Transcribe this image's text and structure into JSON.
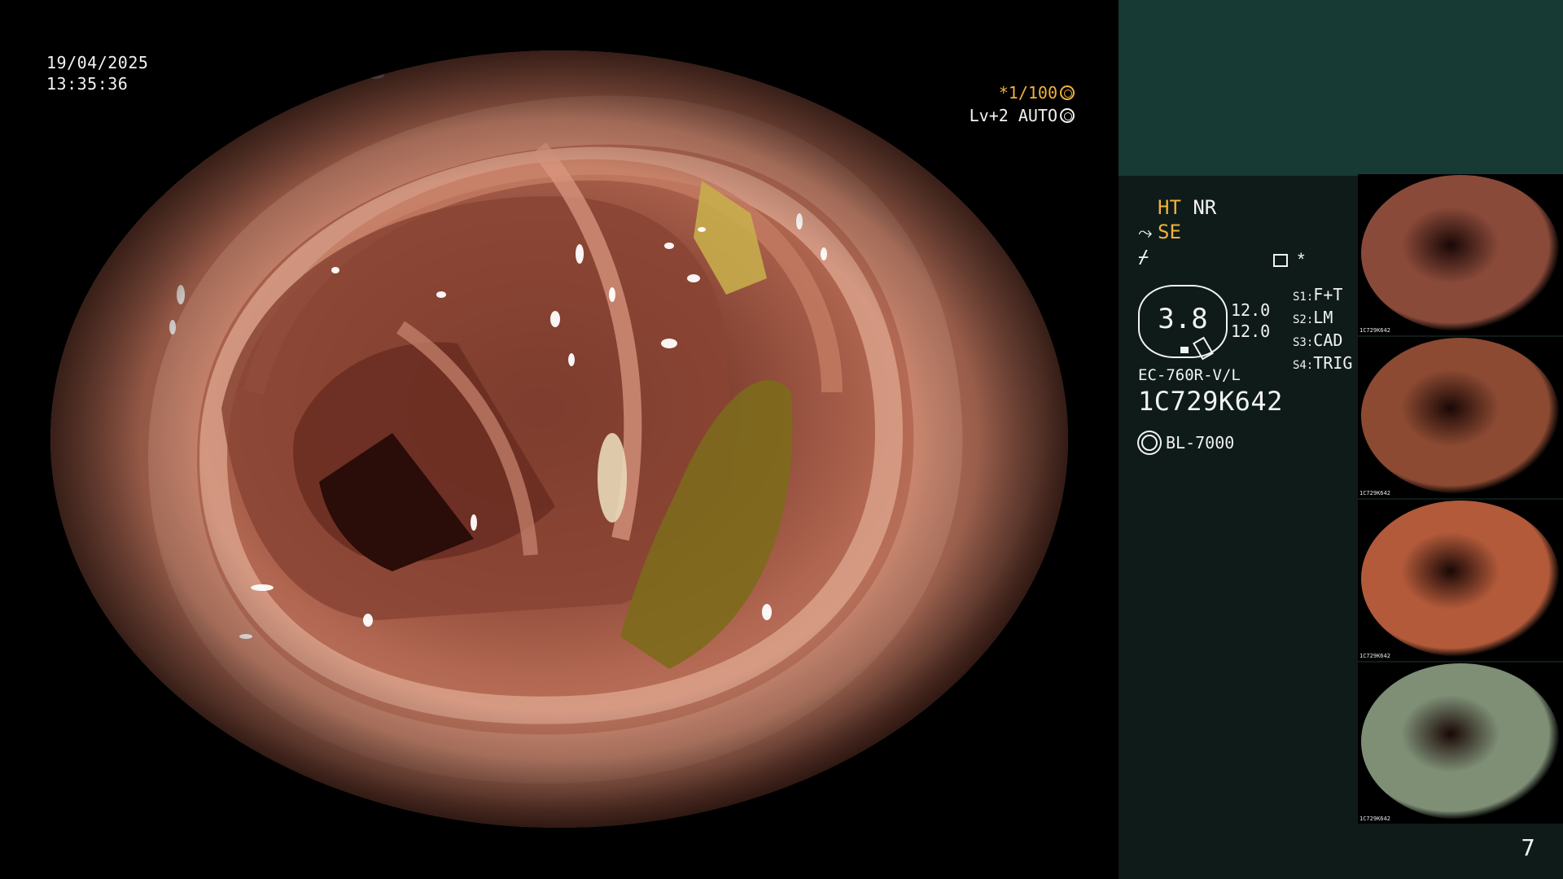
{
  "overlay": {
    "date": "19/04/2025",
    "time": "13:35:36",
    "shutter_speed": "*1/100",
    "level_mode": "Lv+2 AUTO"
  },
  "panel": {
    "mode_primary": "HT",
    "mode_secondary": "NR",
    "enhance": "SE",
    "gauge_value": "3.8",
    "gauge_top": "12.0",
    "gauge_bottom": "12.0",
    "settings": [
      {
        "key": "S1",
        "value": "F+T"
      },
      {
        "key": "S2",
        "value": "LM"
      },
      {
        "key": "S3",
        "value": "CAD"
      },
      {
        "key": "S4",
        "value": "TRIG"
      }
    ],
    "menu_star": "*",
    "scope_model": "EC-760R-V/L",
    "serial": "1C729K642",
    "light_source": "BL-7000",
    "page_number": "7"
  },
  "thumbnails": [
    {
      "serial": "1C729K642",
      "tone": "#8a4a3a"
    },
    {
      "serial": "1C729K642",
      "tone": "#8c4a32"
    },
    {
      "serial": "1C729K642",
      "tone": "#b25a3a"
    },
    {
      "serial": "1C729K642",
      "tone": "#7e8f76"
    }
  ]
}
